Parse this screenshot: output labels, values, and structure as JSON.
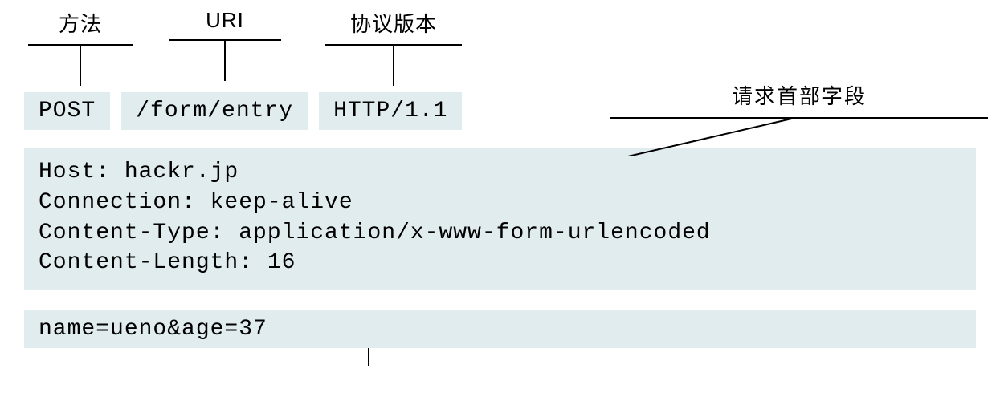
{
  "labels": {
    "method": "方法",
    "uri": "URI",
    "protocol": "协议版本",
    "headers": "请求首部字段"
  },
  "requestLine": {
    "method": "POST",
    "uri": "/form/entry",
    "protocol": "HTTP/1.1"
  },
  "headers": [
    "Host: hackr.jp",
    "Connection: keep-alive",
    "Content-Type: application/x-www-form-urlencoded",
    "Content-Length: 16"
  ],
  "body": "name=ueno&age=37"
}
